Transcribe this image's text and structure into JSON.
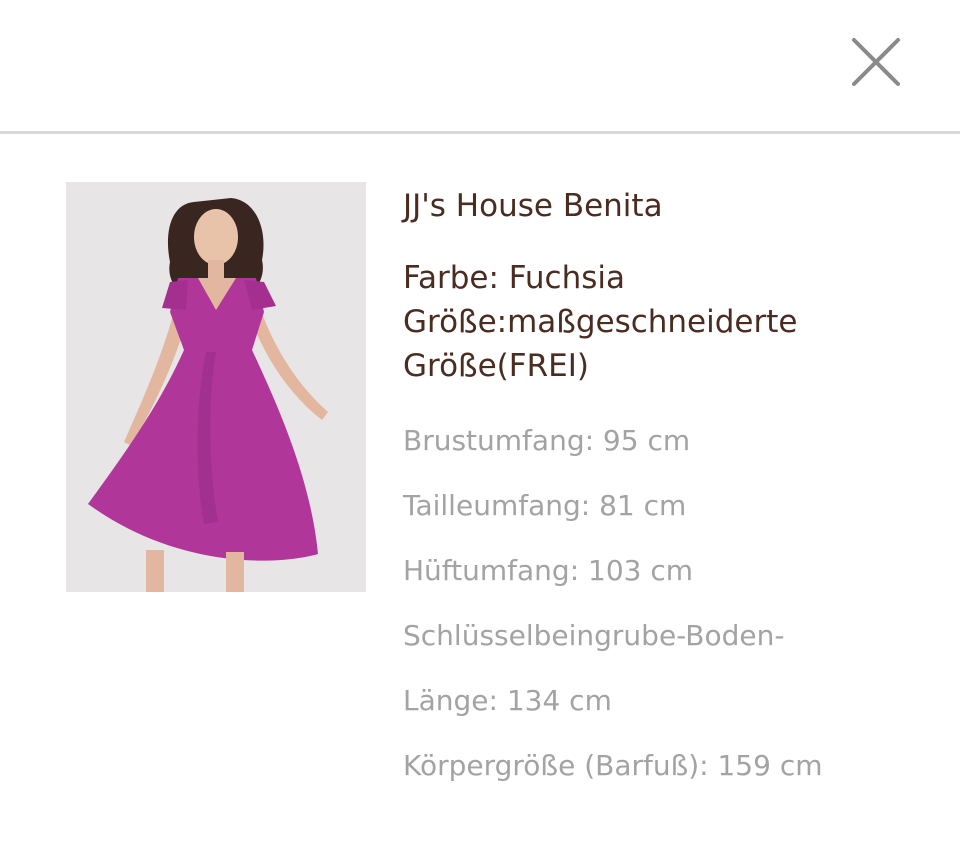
{
  "dialog": {
    "close_icon": "close-icon",
    "close_color": "#8a8a8a"
  },
  "product": {
    "image_alt": "Fuchsia chiffon dress",
    "dress_color": "#b0369a",
    "title": "JJ's House Benita",
    "color_label": "Farbe: Fuchsia",
    "size_line1": "Größe:maßgeschneiderte",
    "size_line2": "Größe(FREI)"
  },
  "measurements": [
    "Brustumfang: 95 cm",
    "Tailleumfang: 81 cm",
    "Hüftumfang: 103 cm",
    "Schlüsselbeingrube-Boden-",
    "Länge: 134 cm",
    "Körpergröße (Barfuß): 159 cm"
  ]
}
